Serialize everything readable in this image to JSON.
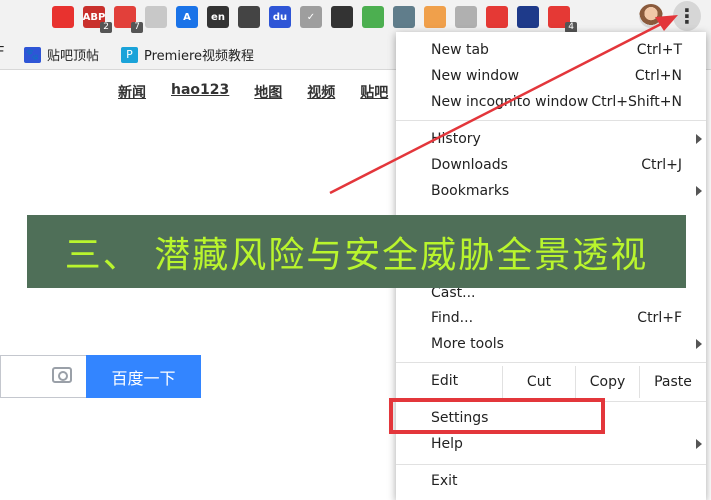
{
  "toolbar": {
    "extensions": [
      {
        "name": "adblock-icon",
        "text": "",
        "badge": "",
        "color": "#e8322f"
      },
      {
        "name": "abp-icon",
        "text": "ABP",
        "badge": "2",
        "color": "#c9302c"
      },
      {
        "name": "red-extension-icon",
        "text": "",
        "badge": "7",
        "color": "#e2403a"
      },
      {
        "name": "gray-circle-icon",
        "text": "",
        "badge": "",
        "color": "#c8c8c8"
      },
      {
        "name": "translate-icon",
        "text": "A",
        "badge": "",
        "color": "#1a73e8"
      },
      {
        "name": "en-dictionary-icon",
        "text": "en",
        "badge": "",
        "color": "#333333"
      },
      {
        "name": "stickman-icon",
        "text": "",
        "badge": "",
        "color": "#444444"
      },
      {
        "name": "baidu-du-icon",
        "text": "du",
        "badge": "",
        "color": "#2e55d6"
      },
      {
        "name": "check-icon",
        "text": "✓",
        "badge": "",
        "color": "#9e9e9e"
      },
      {
        "name": "clock-icon",
        "text": "",
        "badge": "",
        "color": "#333333"
      },
      {
        "name": "colorful-icon",
        "text": "",
        "badge": "",
        "color": "#4caf50"
      },
      {
        "name": "script-icon",
        "text": "",
        "badge": "",
        "color": "#607d8b"
      },
      {
        "name": "cat-face-icon",
        "text": "",
        "badge": "",
        "color": "#f0a04b"
      },
      {
        "name": "grid-icon",
        "text": "",
        "badge": "",
        "color": "#b0b0b0"
      },
      {
        "name": "location-pin-icon",
        "text": "",
        "badge": "",
        "color": "#e53935"
      },
      {
        "name": "forward-arrow-icon",
        "text": "",
        "badge": "",
        "color": "#1e3a8a"
      },
      {
        "name": "chat-icon",
        "text": "",
        "badge": "4",
        "color": "#e53935"
      }
    ],
    "menu_icon": "⋮"
  },
  "bookmarks": [
    {
      "label": "贴吧顶帖",
      "icon": "paw-icon",
      "color": "#2e55d6"
    },
    {
      "label": "Premiere视频教程",
      "icon": "premiere-icon",
      "color": "#1aa3d9"
    }
  ],
  "bookmark_left_fragment": "F",
  "page": {
    "nav_links": [
      "新闻",
      "hao123",
      "地图",
      "视频",
      "贴吧"
    ],
    "search_button": "百度一下"
  },
  "menu": {
    "items": [
      {
        "label": "New tab",
        "shortcut": "Ctrl+T",
        "arrow": false
      },
      {
        "label": "New window",
        "shortcut": "Ctrl+N",
        "arrow": false
      },
      {
        "label": "New incognito window",
        "shortcut": "Ctrl+Shift+N",
        "arrow": false
      },
      {
        "label": "History",
        "shortcut": "",
        "arrow": true
      },
      {
        "label": "Downloads",
        "shortcut": "Ctrl+J",
        "arrow": false
      },
      {
        "label": "Bookmarks",
        "shortcut": "",
        "arrow": true
      },
      {
        "label": "Cast...",
        "shortcut": "",
        "arrow": false
      },
      {
        "label": "Find...",
        "shortcut": "Ctrl+F",
        "arrow": false
      },
      {
        "label": "More tools",
        "shortcut": "",
        "arrow": true
      },
      {
        "label": "Settings",
        "shortcut": "",
        "arrow": false
      },
      {
        "label": "Help",
        "shortcut": "",
        "arrow": true
      },
      {
        "label": "Exit",
        "shortcut": "",
        "arrow": false
      }
    ],
    "edit": {
      "label": "Edit",
      "cut": "Cut",
      "copy": "Copy",
      "paste": "Paste"
    }
  },
  "banner": {
    "text": "三、 潜藏风险与安全威胁全景透视"
  },
  "colors": {
    "banner_bg": "#4f6f58",
    "banner_text": "#b9f52d",
    "annotation_red": "#e3363b",
    "search_button": "#3385ff"
  }
}
